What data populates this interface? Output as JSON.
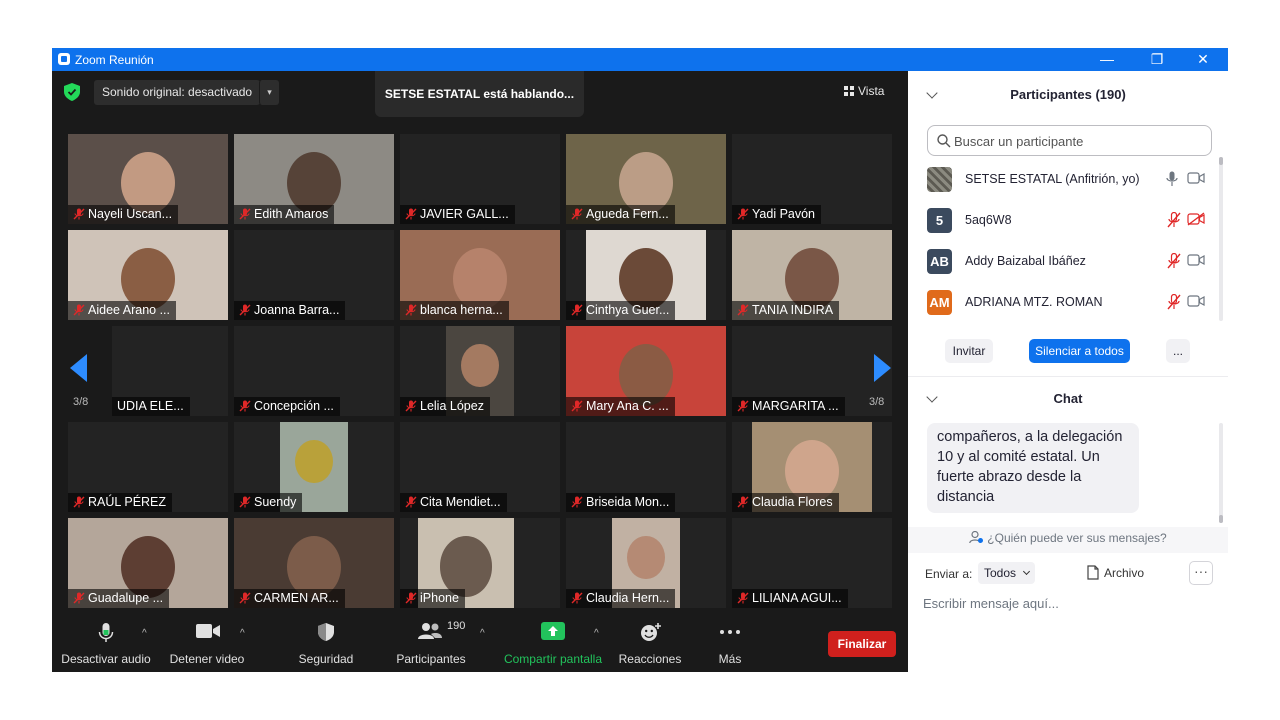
{
  "window": {
    "title": "Zoom Reunión",
    "controls": {
      "minimize": "—",
      "restore": "❐",
      "close": "✕"
    }
  },
  "top_bar": {
    "original_sound": "Sonido original: desactivado",
    "caret": "▾",
    "speaking_banner": "SETSE ESTATAL está hablando...",
    "view_label": "Vista"
  },
  "gallery": {
    "page_indicator": "3/8",
    "tiles": [
      {
        "name": "Nayeli Uscan...",
        "muted": true,
        "video": true,
        "bg": "#5b4f49",
        "face": "#c29a82"
      },
      {
        "name": "Edith Amaros",
        "muted": true,
        "video": true,
        "bg": "#8d8a84",
        "face": "#564338"
      },
      {
        "name": "JAVIER GALL...",
        "muted": true,
        "video": false
      },
      {
        "name": "Agueda Fern...",
        "muted": true,
        "video": true,
        "bg": "#6e6449",
        "face": "#bb9d86"
      },
      {
        "name": "Yadi Pavón",
        "muted": true,
        "video": false
      },
      {
        "name": "Aidee Arano ...",
        "muted": true,
        "video": true,
        "bg": "#cfc3b8",
        "face": "#8a5e44"
      },
      {
        "name": "Joanna Barra...",
        "muted": true,
        "video": false
      },
      {
        "name": "blanca herna...",
        "muted": true,
        "video": true,
        "bg": "#9a6c55",
        "face": "#b6826b"
      },
      {
        "name": "Cinthya Guer...",
        "muted": true,
        "video": true,
        "bg": "#ded8d1",
        "face": "#6b4a38"
      },
      {
        "name": "TANIA INDIRA",
        "muted": true,
        "video": true,
        "bg": "#bfb4a5",
        "face": "#7a5747"
      },
      {
        "name": "UDIA ELE...",
        "muted": false,
        "video": false
      },
      {
        "name": "Concepción ...",
        "muted": true,
        "video": false
      },
      {
        "name": "Lelia López",
        "muted": true,
        "video": true,
        "bg": "#4b4640",
        "face": "#a47a61"
      },
      {
        "name": "Mary Ana C. ...",
        "muted": true,
        "video": true,
        "bg": "#c8443a",
        "face": "#8b5b44"
      },
      {
        "name": "MARGARITA ...",
        "muted": true,
        "video": false
      },
      {
        "name": "RAÚL PÉREZ",
        "muted": true,
        "video": false
      },
      {
        "name": "Suendy",
        "muted": true,
        "video": true,
        "bg": "#9aa69a",
        "face": "#b9a13a"
      },
      {
        "name": "Cita Mendiet...",
        "muted": true,
        "video": false
      },
      {
        "name": "Briseida Mon...",
        "muted": true,
        "video": false
      },
      {
        "name": "Claudia Flores",
        "muted": true,
        "video": true,
        "bg": "#a58f73",
        "face": "#cfa58c"
      },
      {
        "name": "Guadalupe ...",
        "muted": true,
        "video": true,
        "bg": "#b4a69a",
        "face": "#5d3e33"
      },
      {
        "name": "CARMEN AR...",
        "muted": true,
        "video": true,
        "bg": "#4a3b33",
        "face": "#7c5c4a"
      },
      {
        "name": "iPhone",
        "muted": true,
        "video": true,
        "bg": "#c9bfb0",
        "face": "#6b5b4f"
      },
      {
        "name": "Claudia Hern...",
        "muted": true,
        "video": true,
        "bg": "#c1b1a3",
        "face": "#b58a74"
      },
      {
        "name": "LILIANA AGUI...",
        "muted": true,
        "video": false
      }
    ]
  },
  "toolbar": {
    "mute_audio": "Desactivar audio",
    "stop_video": "Detener video",
    "security": "Seguridad",
    "participants": "Participantes",
    "participants_count": "190",
    "share_screen": "Compartir pantalla",
    "reactions": "Reacciones",
    "more": "Más",
    "end": "Finalizar",
    "caret": "^"
  },
  "participants_panel": {
    "title": "Participantes (190)",
    "search_placeholder": "Buscar un participante",
    "list": [
      {
        "name": "SETSE ESTATAL (Anfitrión, yo)",
        "avatar": "",
        "avatar_color": "#6b6a64",
        "muted": false,
        "video_off": false
      },
      {
        "name": "5aq6W8",
        "avatar": "5",
        "avatar_color": "#3b4a5e",
        "muted": true,
        "video_off": true
      },
      {
        "name": "Addy Baizabal Ibáñez",
        "avatar": "AB",
        "avatar_color": "#3b4a5e",
        "muted": true,
        "video_off": false
      },
      {
        "name": "ADRIANA MTZ. ROMAN",
        "avatar": "AM",
        "avatar_color": "#e06a1b",
        "muted": true,
        "video_off": false
      }
    ],
    "invite": "Invitar",
    "mute_all": "Silenciar a todos",
    "more": "..."
  },
  "chat_panel": {
    "title": "Chat",
    "message": "compañeros, a la delegación 10 y al comité estatal. Un fuerte abrazo desde la distancia",
    "who_can_see": "¿Quién puede ver sus mensajes?",
    "send_to_label": "Enviar a:",
    "send_to_value": "Todos",
    "file_label": "Archivo",
    "more": "···",
    "input_placeholder": "Escribir mensaje aquí..."
  },
  "colors": {
    "zoom_blue": "#0e72ed",
    "accent_blue": "#2d8cff",
    "mute_red": "#e02828",
    "end_red": "#d0201d",
    "share_green": "#22c35c",
    "shield_green": "#23d959"
  }
}
